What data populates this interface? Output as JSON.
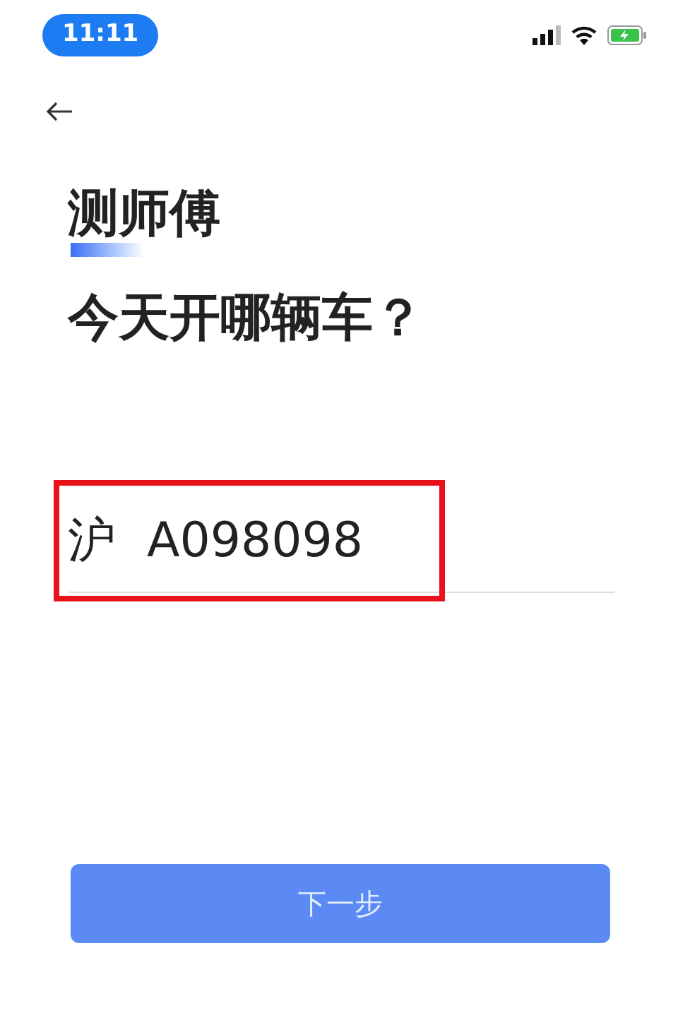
{
  "status_bar": {
    "time": "11:11"
  },
  "greeting": {
    "name": "测师傅",
    "question": "今天开哪辆车？"
  },
  "plate_field": {
    "region": "沪",
    "value": "A098098",
    "highlighted": true
  },
  "next_button": {
    "label": "下一步"
  }
}
